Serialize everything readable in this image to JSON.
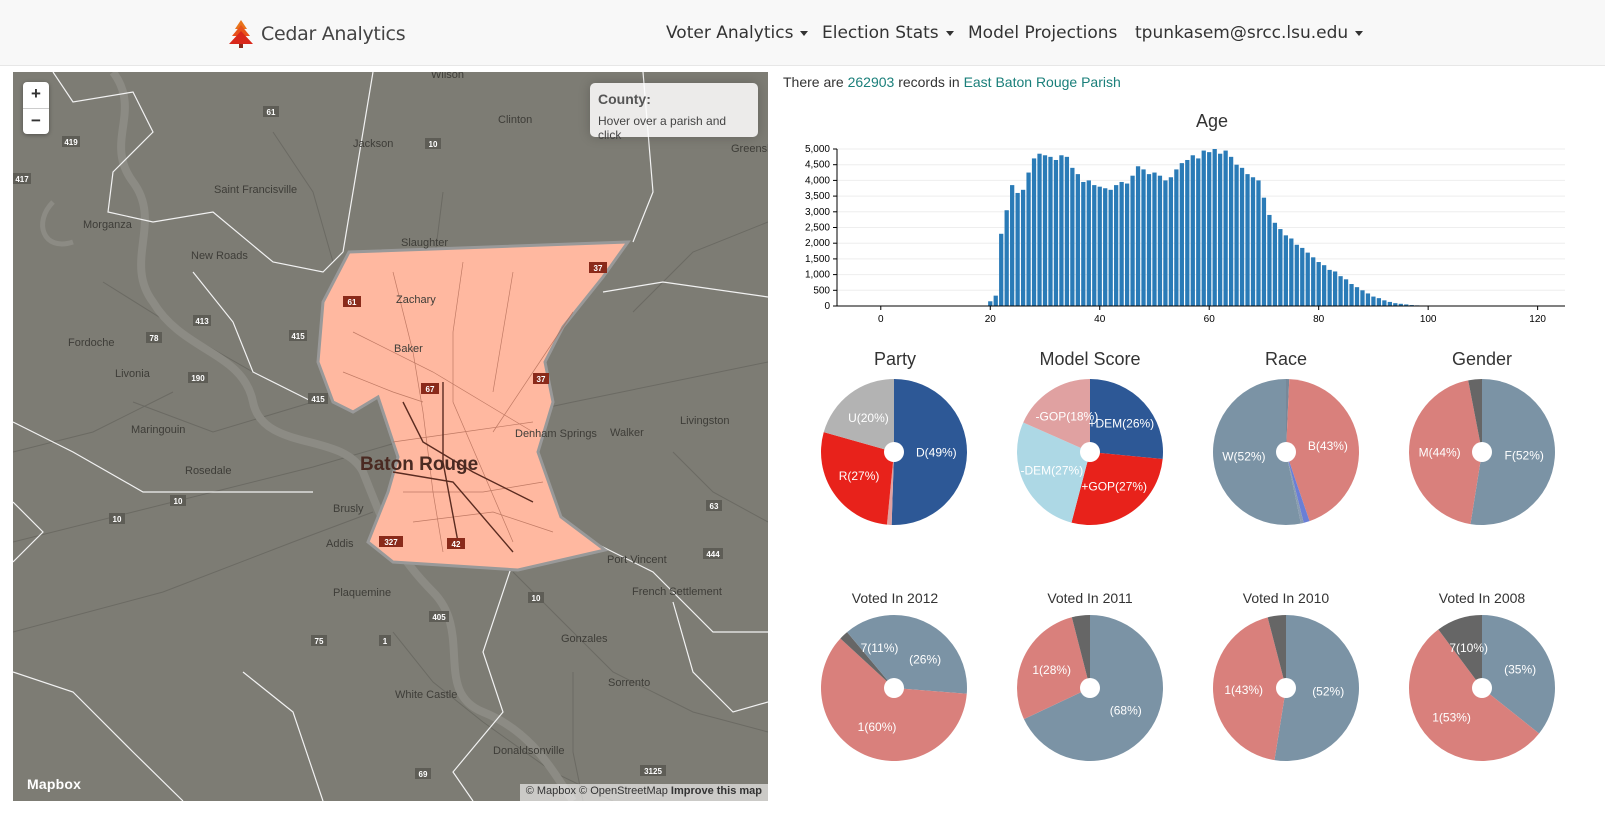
{
  "navbar": {
    "brand": "Cedar Analytics",
    "items": [
      {
        "label": "Voter Analytics",
        "dropdown": true
      },
      {
        "label": "Election Stats",
        "dropdown": true
      },
      {
        "label": "Model Projections",
        "dropdown": false
      },
      {
        "label": "tpunkasem@srcc.lsu.edu",
        "dropdown": true
      }
    ]
  },
  "map": {
    "zoom_in": "+",
    "zoom_out": "−",
    "info_title": "County:",
    "info_hint": "Hover over a parish and click",
    "logo": "Mapbox",
    "attribution": "© Mapbox © OpenStreetMap",
    "improve_link": "Improve this map",
    "selected_color": "#ffb8a0",
    "places": [
      "Wilson",
      "Clinton",
      "Jackson",
      "Greensburg",
      "Saint Francisville",
      "Morganza",
      "Slaughter",
      "New Roads",
      "Zachary",
      "Baker",
      "Fordoche",
      "Livonia",
      "Maringouin",
      "Denham Springs",
      "Walker",
      "Livingston",
      "Baton Rouge",
      "Rosedale",
      "Brusly",
      "Addis",
      "Plaquemine",
      "Port Vincent",
      "French Settlement",
      "Gonzales",
      "Sorrento",
      "White Castle",
      "Donaldsonville"
    ],
    "shields": [
      "61",
      "10",
      "419",
      "417",
      "37",
      "61",
      "413",
      "415",
      "78",
      "190",
      "67",
      "37",
      "415",
      "10",
      "10",
      "327",
      "42",
      "63",
      "444",
      "10",
      "405",
      "1",
      "75",
      "69",
      "3125"
    ]
  },
  "records": {
    "prefix": "There are ",
    "count": "262903",
    "middle": " records in ",
    "parish": "East Baton Rouge Parish"
  },
  "colors": {
    "bar": "#2a7bb7",
    "dem": "#2d5896",
    "gop": "#e8221b",
    "unaffiliated": "#b3b3b3",
    "dem_light": "#add8e5",
    "gop_light": "#e0a1a1",
    "slate": "#7b93a5",
    "salmon": "#d9807c",
    "dark_gray": "#666666",
    "slate_dark": "#778899"
  },
  "chart_data": [
    {
      "type": "bar",
      "title": "Age",
      "xlabel": "",
      "ylabel": "",
      "xlim": [
        -8,
        125
      ],
      "ylim": [
        0,
        5000
      ],
      "xticks": [
        0,
        20,
        40,
        60,
        80,
        100,
        120
      ],
      "yticks": [
        "0",
        "500",
        "1,000",
        "1,500",
        "2,000",
        "2,500",
        "3,000",
        "3,500",
        "4,000",
        "4,500",
        "5,000"
      ],
      "x": [
        20,
        21,
        22,
        23,
        24,
        25,
        26,
        27,
        28,
        29,
        30,
        31,
        32,
        33,
        34,
        35,
        36,
        37,
        38,
        39,
        40,
        41,
        42,
        43,
        44,
        45,
        46,
        47,
        48,
        49,
        50,
        51,
        52,
        53,
        54,
        55,
        56,
        57,
        58,
        59,
        60,
        61,
        62,
        63,
        64,
        65,
        66,
        67,
        68,
        69,
        70,
        71,
        72,
        73,
        74,
        75,
        76,
        77,
        78,
        79,
        80,
        81,
        82,
        83,
        84,
        85,
        86,
        87,
        88,
        89,
        90,
        91,
        92,
        93,
        94,
        95,
        96,
        97,
        98,
        99,
        100,
        101,
        102,
        103,
        104,
        105,
        106,
        107,
        108,
        109,
        110,
        111,
        112,
        113,
        114,
        115,
        116,
        117,
        118,
        119,
        120
      ],
      "values": [
        150,
        330,
        2300,
        3050,
        3850,
        3600,
        3700,
        4250,
        4700,
        4850,
        4800,
        4750,
        4650,
        4800,
        4750,
        4400,
        4200,
        3950,
        4000,
        3850,
        3800,
        3750,
        3700,
        3850,
        3950,
        3900,
        4150,
        4450,
        4350,
        4200,
        4250,
        4150,
        4000,
        4100,
        4350,
        4550,
        4650,
        4800,
        4700,
        4950,
        4900,
        5000,
        4850,
        4950,
        4750,
        4500,
        4400,
        4200,
        4100,
        4000,
        3450,
        2900,
        2650,
        2450,
        2250,
        2150,
        1950,
        1850,
        1700,
        1550,
        1400,
        1300,
        1150,
        1100,
        950,
        850,
        700,
        600,
        500,
        400,
        300,
        250,
        180,
        130,
        90,
        70,
        50,
        30,
        20,
        15,
        10,
        8,
        6,
        5,
        4,
        3,
        2,
        2,
        1,
        1,
        1,
        1,
        0,
        0,
        0,
        0,
        0,
        0,
        0,
        0,
        0
      ]
    },
    {
      "type": "pie",
      "title": "Party",
      "series": [
        {
          "name": "D",
          "value": 49,
          "label": "D(49%)",
          "color": "#2d5896"
        },
        {
          "name": "",
          "value": 1,
          "label": "",
          "color": "#e0a1a1"
        },
        {
          "name": "R",
          "value": 27,
          "label": "R(27%)",
          "color": "#e8221b"
        },
        {
          "name": "U",
          "value": 20,
          "label": "U(20%)",
          "color": "#b3b3b3"
        }
      ]
    },
    {
      "type": "pie",
      "title": "Model Score",
      "series": [
        {
          "name": "+DEM",
          "value": 26,
          "label": "+DEM(26%)",
          "color": "#2d5896"
        },
        {
          "name": "+GOP",
          "value": 27,
          "label": "+GOP(27%)",
          "color": "#e8221b"
        },
        {
          "name": "-DEM",
          "value": 27,
          "label": "-DEM(27%)",
          "color": "#add8e5"
        },
        {
          "name": "-GOP",
          "value": 18,
          "label": "-GOP(18%)",
          "color": "#e0a1a1"
        }
      ]
    },
    {
      "type": "pie",
      "title": "Race",
      "series": [
        {
          "name": "",
          "value": 0.7,
          "label": "",
          "color": "#778899"
        },
        {
          "name": "B",
          "value": 43,
          "label": "B(43%)",
          "color": "#d9807c"
        },
        {
          "name": "",
          "value": 1.3,
          "label": "",
          "color": "#6a7fd6"
        },
        {
          "name": "",
          "value": 0.6,
          "label": "",
          "color": "#8a9cb0"
        },
        {
          "name": "W",
          "value": 52,
          "label": "W(52%)",
          "color": "#7b93a5"
        }
      ]
    },
    {
      "type": "pie",
      "title": "Gender",
      "series": [
        {
          "name": "F",
          "value": 52,
          "label": "F(52%)",
          "color": "#7b93a5"
        },
        {
          "name": "M",
          "value": 44,
          "label": "M(44%)",
          "color": "#d9807c"
        },
        {
          "name": "",
          "value": 3,
          "label": "",
          "color": "#666666"
        }
      ]
    },
    {
      "type": "pie",
      "title": "Voted In 2012",
      "series": [
        {
          "name": "",
          "value": 26,
          "label": "(26%)",
          "color": "#7b93a5"
        },
        {
          "name": "1",
          "value": 60,
          "label": "1(60%)",
          "color": "#d9807c"
        },
        {
          "name": "",
          "value": 2,
          "label": "",
          "color": "#666666"
        },
        {
          "name": "7",
          "value": 11,
          "label": "7(11%)",
          "color": "#7b93a5"
        }
      ]
    },
    {
      "type": "pie",
      "title": "Voted In 2011",
      "series": [
        {
          "name": "",
          "value": 68,
          "label": "(68%)",
          "color": "#7b93a5"
        },
        {
          "name": "1",
          "value": 28,
          "label": "1(28%)",
          "color": "#d9807c"
        },
        {
          "name": "",
          "value": 4,
          "label": "",
          "color": "#666666"
        }
      ]
    },
    {
      "type": "pie",
      "title": "Voted In 2010",
      "series": [
        {
          "name": "",
          "value": 52,
          "label": "(52%)",
          "color": "#7b93a5"
        },
        {
          "name": "1",
          "value": 43,
          "label": "1(43%)",
          "color": "#d9807c"
        },
        {
          "name": "",
          "value": 4,
          "label": "",
          "color": "#666666"
        }
      ]
    },
    {
      "type": "pie",
      "title": "Voted In 2008",
      "series": [
        {
          "name": "",
          "value": 35,
          "label": "(35%)",
          "color": "#7b93a5"
        },
        {
          "name": "1",
          "value": 53,
          "label": "1(53%)",
          "color": "#d9807c"
        },
        {
          "name": "7",
          "value": 10,
          "label": "7(10%)",
          "color": "#666666"
        }
      ]
    }
  ]
}
